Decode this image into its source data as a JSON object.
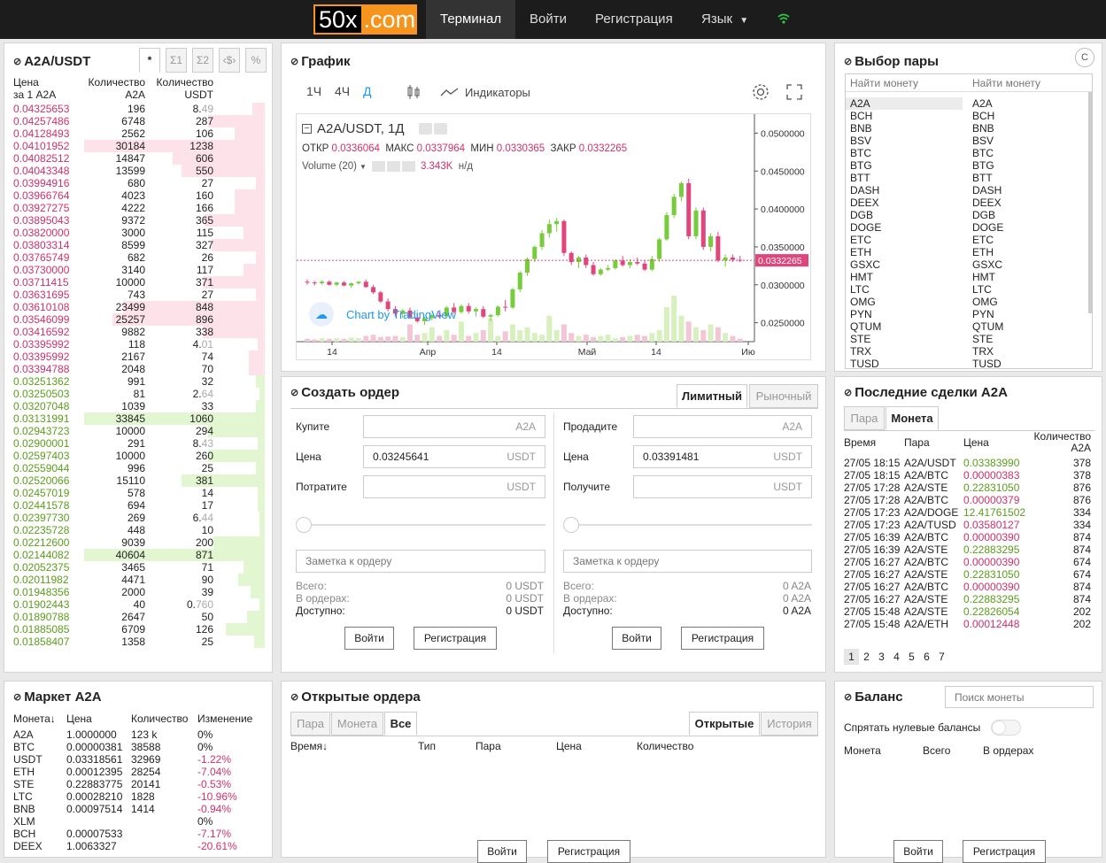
{
  "nav": {
    "logo_a": "50x",
    "logo_b": ".com",
    "terminal": "Терминал",
    "login": "Войти",
    "register": "Регистрация",
    "language": "Язык"
  },
  "orderbook": {
    "title": "A2A/USDT",
    "tabs": [
      "*",
      "Σ1",
      "Σ2",
      "‹$›",
      "%"
    ],
    "headers": {
      "price1": "Цена",
      "price2": "за 1 A2A",
      "qty1": "Количество",
      "qty2": "A2A",
      "tot1": "Количество",
      "tot2": "USDT"
    },
    "asks": [
      {
        "price": "0.04325653",
        "qty": "196",
        "total": "8.",
        "dim": "49",
        "depth": 0.05
      },
      {
        "price": "0.04257486",
        "qty": "6748",
        "total": "287",
        "dim": "",
        "depth": 0.3
      },
      {
        "price": "0.04128493",
        "qty": "2562",
        "total": "106",
        "dim": "",
        "depth": 0.15
      },
      {
        "price": "0.04101952",
        "qty": "30184",
        "total": "1238",
        "dim": "",
        "depth": 1.0
      },
      {
        "price": "0.04082512",
        "qty": "14847",
        "total": "606",
        "dim": "",
        "depth": 0.5
      },
      {
        "price": "0.04043348",
        "qty": "13599",
        "total": "550",
        "dim": "",
        "depth": 0.45
      },
      {
        "price": "0.03994916",
        "qty": "680",
        "total": "27",
        "dim": "",
        "depth": 0.03
      },
      {
        "price": "0.03966764",
        "qty": "4023",
        "total": "160",
        "dim": "",
        "depth": 0.15
      },
      {
        "price": "0.03927275",
        "qty": "4222",
        "total": "166",
        "dim": "",
        "depth": 0.15
      },
      {
        "price": "0.03895043",
        "qty": "9372",
        "total": "365",
        "dim": "",
        "depth": 0.32
      },
      {
        "price": "0.03820000",
        "qty": "3000",
        "total": "115",
        "dim": "",
        "depth": 0.1
      },
      {
        "price": "0.03803314",
        "qty": "8599",
        "total": "327",
        "dim": "",
        "depth": 0.28
      },
      {
        "price": "0.03765749",
        "qty": "682",
        "total": "26",
        "dim": "",
        "depth": 0.03
      },
      {
        "price": "0.03730000",
        "qty": "3140",
        "total": "117",
        "dim": "",
        "depth": 0.1
      },
      {
        "price": "0.03711415",
        "qty": "10000",
        "total": "371",
        "dim": "",
        "depth": 0.33
      },
      {
        "price": "0.03631695",
        "qty": "743",
        "total": "27",
        "dim": "",
        "depth": 0.03
      },
      {
        "price": "0.03610108",
        "qty": "23499",
        "total": "848",
        "dim": "",
        "depth": 0.78
      },
      {
        "price": "0.03546099",
        "qty": "25257",
        "total": "896",
        "dim": "",
        "depth": 0.84
      },
      {
        "price": "0.03416592",
        "qty": "9882",
        "total": "338",
        "dim": "",
        "depth": 0.33
      },
      {
        "price": "0.03395992",
        "qty": "118",
        "total": "4.",
        "dim": "01",
        "depth": 0.02
      },
      {
        "price": "0.03395992",
        "qty": "2167",
        "total": "74",
        "dim": "",
        "depth": 0.07
      },
      {
        "price": "0.03394788",
        "qty": "2048",
        "total": "70",
        "dim": "",
        "depth": 0.07
      }
    ],
    "bids": [
      {
        "price": "0.03251362",
        "qty": "991",
        "total": "32",
        "dim": "",
        "depth": 0.03
      },
      {
        "price": "0.03250503",
        "qty": "81",
        "total": "2.",
        "dim": "64",
        "depth": 0.01
      },
      {
        "price": "0.03207048",
        "qty": "1039",
        "total": "33",
        "dim": "",
        "depth": 0.03
      },
      {
        "price": "0.03131991",
        "qty": "33845",
        "total": "1060",
        "dim": "",
        "depth": 1.0
      },
      {
        "price": "0.02943723",
        "qty": "10000",
        "total": "294",
        "dim": "",
        "depth": 0.3
      },
      {
        "price": "0.02900001",
        "qty": "291",
        "total": "8.",
        "dim": "43",
        "depth": 0.02
      },
      {
        "price": "0.02597403",
        "qty": "10000",
        "total": "260",
        "dim": "",
        "depth": 0.3
      },
      {
        "price": "0.02559044",
        "qty": "996",
        "total": "25",
        "dim": "",
        "depth": 0.03
      },
      {
        "price": "0.02520066",
        "qty": "15110",
        "total": "381",
        "dim": "",
        "depth": 0.45
      },
      {
        "price": "0.02457019",
        "qty": "578",
        "total": "14",
        "dim": "",
        "depth": 0.02
      },
      {
        "price": "0.02441578",
        "qty": "694",
        "total": "17",
        "dim": "",
        "depth": 0.02
      },
      {
        "price": "0.02397730",
        "qty": "269",
        "total": "6.",
        "dim": "44",
        "depth": 0.01
      },
      {
        "price": "0.02235728",
        "qty": "448",
        "total": "10",
        "dim": "",
        "depth": 0.01
      },
      {
        "price": "0.02212600",
        "qty": "9039",
        "total": "200",
        "dim": "",
        "depth": 0.27
      },
      {
        "price": "0.02144082",
        "qty": "40604",
        "total": "871",
        "dim": "",
        "depth": 1.0
      },
      {
        "price": "0.02052375",
        "qty": "3465",
        "total": "71",
        "dim": "",
        "depth": 0.1
      },
      {
        "price": "0.02011982",
        "qty": "4471",
        "total": "90",
        "dim": "",
        "depth": 0.13
      },
      {
        "price": "0.01948356",
        "qty": "2000",
        "total": "39",
        "dim": "",
        "depth": 0.06
      },
      {
        "price": "0.01902443",
        "qty": "40",
        "total": "0.",
        "dim": "760",
        "depth": 0.01
      },
      {
        "price": "0.01890788",
        "qty": "2647",
        "total": "50",
        "dim": "",
        "depth": 0.08
      },
      {
        "price": "0.01885085",
        "qty": "6709",
        "total": "126",
        "dim": "",
        "depth": 0.2
      },
      {
        "price": "0.01858407",
        "qty": "1358",
        "total": "25",
        "dim": "",
        "depth": 0.04
      }
    ]
  },
  "chart_panel": {
    "title": "График",
    "intervals": [
      "1Ч",
      "4Ч",
      "Д"
    ],
    "indicators": "Индикаторы",
    "symbol": "A2A/USDT, 1Д",
    "o_label": "ОТКР",
    "o_val": "0.0336064",
    "h_label": "МАКС",
    "h_val": "0.0337964",
    "l_label": "МИН",
    "l_val": "0.0330365",
    "c_label": "ЗАКР",
    "c_val": "0.0332265",
    "volume_label": "Volume (20)",
    "volume_val": "3.343K",
    "volume_na": "н/д",
    "watermark": "Chart by TradingView",
    "last_price": "0.0332265"
  },
  "chart_data": {
    "type": "candlestick",
    "y_ticks": [
      "0.0500000",
      "0.0450000",
      "0.0400000",
      "0.0350000",
      "0.0300000",
      "0.0250000"
    ],
    "ylim": [
      0.0225,
      0.0525
    ],
    "x_ticks": [
      "14",
      "Апр",
      "14",
      "Май",
      "14",
      "Ию"
    ],
    "candles": [
      [
        0.0304,
        0.0307,
        0.03,
        0.0303
      ],
      [
        0.0303,
        0.0305,
        0.0299,
        0.0302
      ],
      [
        0.0302,
        0.0306,
        0.03,
        0.0304
      ],
      [
        0.0304,
        0.0306,
        0.0299,
        0.03
      ],
      [
        0.03,
        0.0304,
        0.0298,
        0.0303
      ],
      [
        0.0303,
        0.0305,
        0.0298,
        0.0299
      ],
      [
        0.0299,
        0.0303,
        0.0296,
        0.0302
      ],
      [
        0.0302,
        0.0305,
        0.03,
        0.0304
      ],
      [
        0.0304,
        0.0307,
        0.0296,
        0.0297
      ],
      [
        0.0297,
        0.03,
        0.0288,
        0.029
      ],
      [
        0.029,
        0.0292,
        0.0276,
        0.0278
      ],
      [
        0.0278,
        0.0282,
        0.0265,
        0.0268
      ],
      [
        0.0268,
        0.0272,
        0.0258,
        0.0262
      ],
      [
        0.0262,
        0.0268,
        0.0256,
        0.0266
      ],
      [
        0.0266,
        0.027,
        0.0255,
        0.0257
      ],
      [
        0.0257,
        0.0262,
        0.025,
        0.0252
      ],
      [
        0.0252,
        0.0258,
        0.0247,
        0.0256
      ],
      [
        0.0256,
        0.0262,
        0.0253,
        0.026
      ],
      [
        0.026,
        0.0266,
        0.0256,
        0.0258
      ],
      [
        0.0258,
        0.0272,
        0.0256,
        0.027
      ],
      [
        0.027,
        0.0276,
        0.0262,
        0.0264
      ],
      [
        0.0264,
        0.0274,
        0.0262,
        0.0272
      ],
      [
        0.0272,
        0.0276,
        0.0262,
        0.0265
      ],
      [
        0.0265,
        0.027,
        0.0258,
        0.0268
      ],
      [
        0.0268,
        0.0272,
        0.0256,
        0.0258
      ],
      [
        0.0258,
        0.0262,
        0.0252,
        0.026
      ],
      [
        0.026,
        0.0273,
        0.0258,
        0.0271
      ],
      [
        0.0271,
        0.028,
        0.0265,
        0.027
      ],
      [
        0.027,
        0.0296,
        0.0268,
        0.0294
      ],
      [
        0.0294,
        0.0318,
        0.029,
        0.0316
      ],
      [
        0.0316,
        0.0336,
        0.0312,
        0.0334
      ],
      [
        0.0334,
        0.0352,
        0.033,
        0.035
      ],
      [
        0.035,
        0.0372,
        0.0346,
        0.0368
      ],
      [
        0.0368,
        0.0386,
        0.0362,
        0.038
      ],
      [
        0.038,
        0.0388,
        0.037,
        0.0384
      ],
      [
        0.0384,
        0.0386,
        0.0338,
        0.0342
      ],
      [
        0.0342,
        0.0344,
        0.0326,
        0.033
      ],
      [
        0.033,
        0.0338,
        0.0322,
        0.0336
      ],
      [
        0.0336,
        0.034,
        0.0322,
        0.0326
      ],
      [
        0.0326,
        0.033,
        0.0312,
        0.0314
      ],
      [
        0.0314,
        0.0322,
        0.0312,
        0.032
      ],
      [
        0.032,
        0.0326,
        0.0318,
        0.0322
      ],
      [
        0.0322,
        0.0334,
        0.032,
        0.0332
      ],
      [
        0.0332,
        0.0338,
        0.0324,
        0.0326
      ],
      [
        0.0326,
        0.0334,
        0.0322,
        0.033
      ],
      [
        0.033,
        0.0336,
        0.0326,
        0.0328
      ],
      [
        0.0328,
        0.0332,
        0.0318,
        0.032
      ],
      [
        0.032,
        0.0338,
        0.0318,
        0.0334
      ],
      [
        0.0334,
        0.0362,
        0.033,
        0.036
      ],
      [
        0.036,
        0.0396,
        0.0358,
        0.0392
      ],
      [
        0.0392,
        0.042,
        0.0388,
        0.0416
      ],
      [
        0.0416,
        0.0436,
        0.041,
        0.0434
      ],
      [
        0.0434,
        0.044,
        0.036,
        0.0364
      ],
      [
        0.0364,
        0.0402,
        0.036,
        0.0398
      ],
      [
        0.0398,
        0.0402,
        0.0346,
        0.035
      ],
      [
        0.035,
        0.0368,
        0.0344,
        0.0364
      ],
      [
        0.0364,
        0.037,
        0.033,
        0.0332
      ],
      [
        0.0332,
        0.034,
        0.0324,
        0.0336
      ],
      [
        0.0336,
        0.034,
        0.033,
        0.0333
      ],
      [
        0.0333,
        0.0338,
        0.033,
        0.0332
      ]
    ],
    "volumes": [
      0.05,
      0.04,
      0.06,
      0.05,
      0.06,
      0.05,
      0.07,
      0.06,
      0.1,
      0.12,
      0.08,
      0.09,
      0.1,
      0.08,
      0.3,
      0.12,
      0.15,
      0.25,
      0.1,
      0.2,
      0.12,
      0.35,
      0.1,
      0.15,
      0.2,
      0.4,
      0.1,
      0.18,
      0.3,
      0.2,
      0.25,
      0.15,
      0.12,
      0.45,
      0.2,
      0.3,
      0.15,
      0.1,
      0.12,
      0.08,
      0.1,
      0.12,
      0.06,
      0.08,
      0.1,
      0.12,
      0.1,
      0.15,
      0.2,
      0.6,
      0.8,
      0.45,
      0.35,
      0.25,
      0.2,
      0.3,
      0.25,
      0.15,
      0.1,
      0.05
    ],
    "last": 0.0332265
  },
  "pair_select": {
    "title": "Выбор пары",
    "search1": "Найти монету",
    "search2": "Найти монету",
    "coins": [
      "A2A",
      "BCH",
      "BNB",
      "BSV",
      "BTC",
      "BTG",
      "BTT",
      "DASH",
      "DEEX",
      "DGB",
      "DOGE",
      "ETC",
      "ETH",
      "GSXC",
      "HMT",
      "LTC",
      "OMG",
      "PYN",
      "QTUM",
      "STE",
      "TRX",
      "TUSD"
    ]
  },
  "create_order": {
    "title": "Создать ордер",
    "tab_limit": "Лимитный",
    "tab_market": "Рыночный",
    "buy": {
      "label1": "Купите",
      "unit1": "A2A",
      "label2": "Цена",
      "value2": "0.03245641",
      "unit2": "USDT",
      "label3": "Потратите",
      "unit3": "USDT",
      "note": "Заметка к ордеру",
      "total": "Всего:",
      "total_val": "0 USDT",
      "inorders": "В ордерах:",
      "inorders_val": "0 USDT",
      "available": "Доступно:",
      "available_val": "0 USDT",
      "login": "Войти",
      "register": "Регистрация"
    },
    "sell": {
      "label1": "Продадите",
      "unit1": "A2A",
      "label2": "Цена",
      "value2": "0.03391481",
      "unit2": "USDT",
      "label3": "Получите",
      "unit3": "USDT",
      "note": "Заметка к ордеру",
      "total": "Всего:",
      "total_val": "0 A2A",
      "inorders": "В ордерах:",
      "inorders_val": "0 A2A",
      "available": "Доступно:",
      "available_val": "0 A2A",
      "login": "Войти",
      "register": "Регистрация"
    }
  },
  "trades": {
    "title": "Последние сделки A2A",
    "tab_pair": "Пара",
    "tab_coin": "Монета",
    "h_time": "Время",
    "h_pair": "Пара",
    "h_price": "Цена",
    "h_qty1": "Количество",
    "h_qty2": "A2A",
    "rows": [
      {
        "time": "27/05 18:15",
        "pair": "A2A/USDT",
        "price": "0.03383990",
        "qty": "378",
        "side": "green"
      },
      {
        "time": "27/05 18:15",
        "pair": "A2A/BTC",
        "price": "0.00000383",
        "qty": "378",
        "side": "red"
      },
      {
        "time": "27/05 17:28",
        "pair": "A2A/STE",
        "price": "0.22831050",
        "qty": "876",
        "side": "green"
      },
      {
        "time": "27/05 17:28",
        "pair": "A2A/BTC",
        "price": "0.00000379",
        "qty": "876",
        "side": "red"
      },
      {
        "time": "27/05 17:23",
        "pair": "A2A/DOGE",
        "price": "12.41761502",
        "qty": "334",
        "side": "green"
      },
      {
        "time": "27/05 17:23",
        "pair": "A2A/TUSD",
        "price": "0.03580127",
        "qty": "334",
        "side": "red"
      },
      {
        "time": "27/05 16:39",
        "pair": "A2A/BTC",
        "price": "0.00000390",
        "qty": "874",
        "side": "red"
      },
      {
        "time": "27/05 16:39",
        "pair": "A2A/STE",
        "price": "0.22883295",
        "qty": "874",
        "side": "green"
      },
      {
        "time": "27/05 16:27",
        "pair": "A2A/BTC",
        "price": "0.00000390",
        "qty": "674",
        "side": "red"
      },
      {
        "time": "27/05 16:27",
        "pair": "A2A/STE",
        "price": "0.22831050",
        "qty": "674",
        "side": "green"
      },
      {
        "time": "27/05 16:27",
        "pair": "A2A/BTC",
        "price": "0.00000390",
        "qty": "874",
        "side": "red"
      },
      {
        "time": "27/05 16:27",
        "pair": "A2A/STE",
        "price": "0.22883295",
        "qty": "874",
        "side": "green"
      },
      {
        "time": "27/05 15:48",
        "pair": "A2A/STE",
        "price": "0.22826054",
        "qty": "202",
        "side": "green"
      },
      {
        "time": "27/05 15:48",
        "pair": "A2A/ETH",
        "price": "0.00012448",
        "qty": "202",
        "side": "red"
      }
    ],
    "pages": [
      "1",
      "2",
      "3",
      "4",
      "5",
      "6",
      "7"
    ]
  },
  "market": {
    "title": "Маркет A2A",
    "h_coin": "Монета",
    "h_price": "Цена",
    "h_qty": "Количество",
    "h_change": "Изменение",
    "rows": [
      {
        "coin": "A2A",
        "price": "1.0000000",
        "qty": "123 k",
        "change": "0%",
        "side": "neutral"
      },
      {
        "coin": "BTC",
        "price": "0.00000381",
        "qty": "38588",
        "change": "0%",
        "side": "neutral"
      },
      {
        "coin": "USDT",
        "price": "0.03318561",
        "qty": "32969",
        "change": "-1.22%",
        "side": "red"
      },
      {
        "coin": "ETH",
        "price": "0.00012395",
        "qty": "28254",
        "change": "-7.04%",
        "side": "red"
      },
      {
        "coin": "STE",
        "price": "0.22883775",
        "qty": "20141",
        "change": "-0.53%",
        "side": "red"
      },
      {
        "coin": "LTC",
        "price": "0.00028210",
        "qty": "1828",
        "change": "-10.96%",
        "side": "red"
      },
      {
        "coin": "BNB",
        "price": "0.00097514",
        "qty": "1414",
        "change": "-0.94%",
        "side": "red"
      },
      {
        "coin": "XLM",
        "price": "",
        "qty": "",
        "change": "0%",
        "side": "neutral"
      },
      {
        "coin": "BCH",
        "price": "0.00007533",
        "qty": "",
        "change": "-7.17%",
        "side": "red"
      },
      {
        "coin": "DEEX",
        "price": "1.0063327",
        "qty": "",
        "change": "-20.61%",
        "side": "red"
      }
    ]
  },
  "open_orders": {
    "title": "Открытые ордера",
    "tab_pair": "Пара",
    "tab_coin": "Монета",
    "tab_all": "Все",
    "tab_open": "Открытые",
    "tab_history": "История",
    "h_time": "Время",
    "h_type": "Тип",
    "h_pair": "Пара",
    "h_price": "Цена",
    "h_qty": "Количество",
    "login": "Войти",
    "register": "Регистрация"
  },
  "balance": {
    "title": "Баланс",
    "search": "Поиск монеты",
    "hide_zero": "Спрятать нулевые балансы",
    "h_coin": "Монета",
    "h_total": "Всего",
    "h_inorders": "В ордерах",
    "login": "Войти",
    "register": "Регистрация"
  },
  "colors": {
    "ask": "#d1306b",
    "bid": "#5a9e1a",
    "accent": "#f7941d",
    "blue": "#2196f3"
  }
}
